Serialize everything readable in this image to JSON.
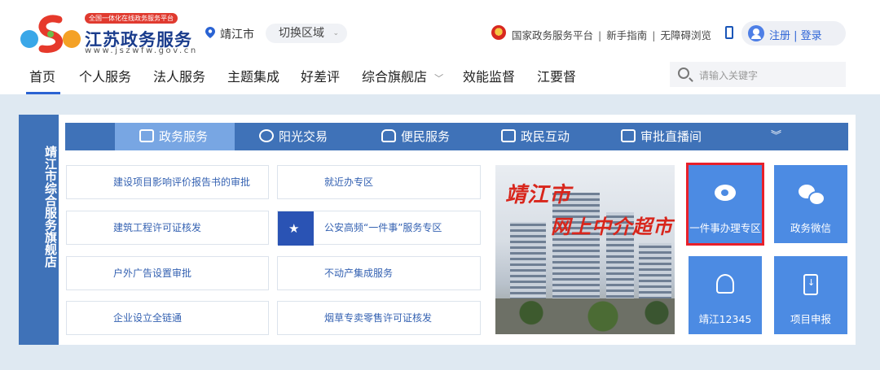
{
  "header": {
    "badge": "全国一体化在线政务服务平台",
    "title": "江苏政务服务",
    "url": "www.jszwfw.gov.cn",
    "location": "靖江市",
    "switch_region": "切换区域",
    "links": [
      "国家政务服务平台",
      "新手指南",
      "无障碍浏览"
    ],
    "login": "注册 | 登录"
  },
  "nav": {
    "items": [
      "首页",
      "个人服务",
      "法人服务",
      "主题集成",
      "好差评",
      "综合旗舰店",
      "效能监督",
      "江要督"
    ],
    "active_index": 0,
    "search_placeholder": "请输入关键字"
  },
  "store": {
    "vertical_title": "靖江市综合服务旗舰店",
    "tabs": [
      "政务服务",
      "阳光交易",
      "便民服务",
      "政民互动",
      "审批直播间"
    ],
    "active_tab": 0,
    "services_left": [
      "建设项目影响评价报告书的审批",
      "建筑工程许可证核发",
      "户外广告设置审批",
      "企业设立全链通"
    ],
    "services_right": [
      "就近办专区",
      "公安高频“一件事”服务专区",
      "不动产集成服务",
      "烟草专卖零售许可证核发"
    ],
    "photo_text_1": "靖江市",
    "photo_text_2": "网上中介超市",
    "tiles": [
      "一件事办理专区",
      "政务微信",
      "靖江12345",
      "项目申报"
    ]
  },
  "colors": {
    "primary": "#3f72b8",
    "accent": "#2a63d3",
    "tile": "#4c8be3",
    "highlight": "#e8202a"
  }
}
